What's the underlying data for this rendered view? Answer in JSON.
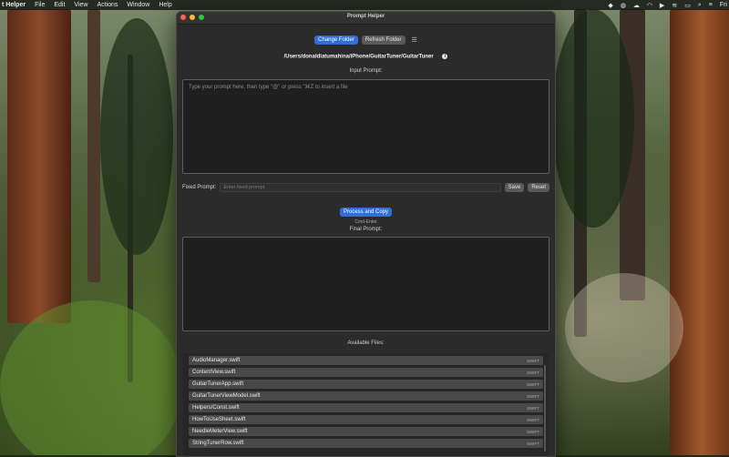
{
  "menubar": {
    "app_name": "t Helper",
    "items": [
      "File",
      "Edit",
      "View",
      "Actions",
      "Window",
      "Help"
    ],
    "right_text": "Fri"
  },
  "window": {
    "title": "Prompt Helper",
    "change_folder": "Change Folder",
    "refresh_folder": "Refresh Folder",
    "folder_path": "/Users/donaldiatumahina/iPhone/GuitarTuner/GuitarTuner",
    "input_label": "Input Prompt:",
    "input_placeholder": "Type your prompt here, then type \"@\" or press \"⌘Z to insert a file",
    "fixed_label": "Fixed Prompt:",
    "fixed_placeholder": "Enter fixed prompt",
    "save": "Save",
    "reset": "Reset",
    "process": "Process and Copy",
    "process_hint": "Cmd-Enter",
    "final_label": "Final Prompt:",
    "files_label": "Available Files:",
    "files": [
      {
        "name": "AudioManager.swift",
        "tag": "SWIFT"
      },
      {
        "name": "ContentView.swift",
        "tag": "SWIFT"
      },
      {
        "name": "GuitarTunerApp.swift",
        "tag": "SWIFT"
      },
      {
        "name": "GuitarTunerViewModel.swift",
        "tag": "SWIFT"
      },
      {
        "name": "Helpers/Const.swift",
        "tag": "SWIFT"
      },
      {
        "name": "HowToUseSheet.swift",
        "tag": "SWIFT"
      },
      {
        "name": "NeedleMeterView.swift",
        "tag": "SWIFT"
      },
      {
        "name": "StringTunerRow.swift",
        "tag": "SWIFT"
      }
    ]
  }
}
